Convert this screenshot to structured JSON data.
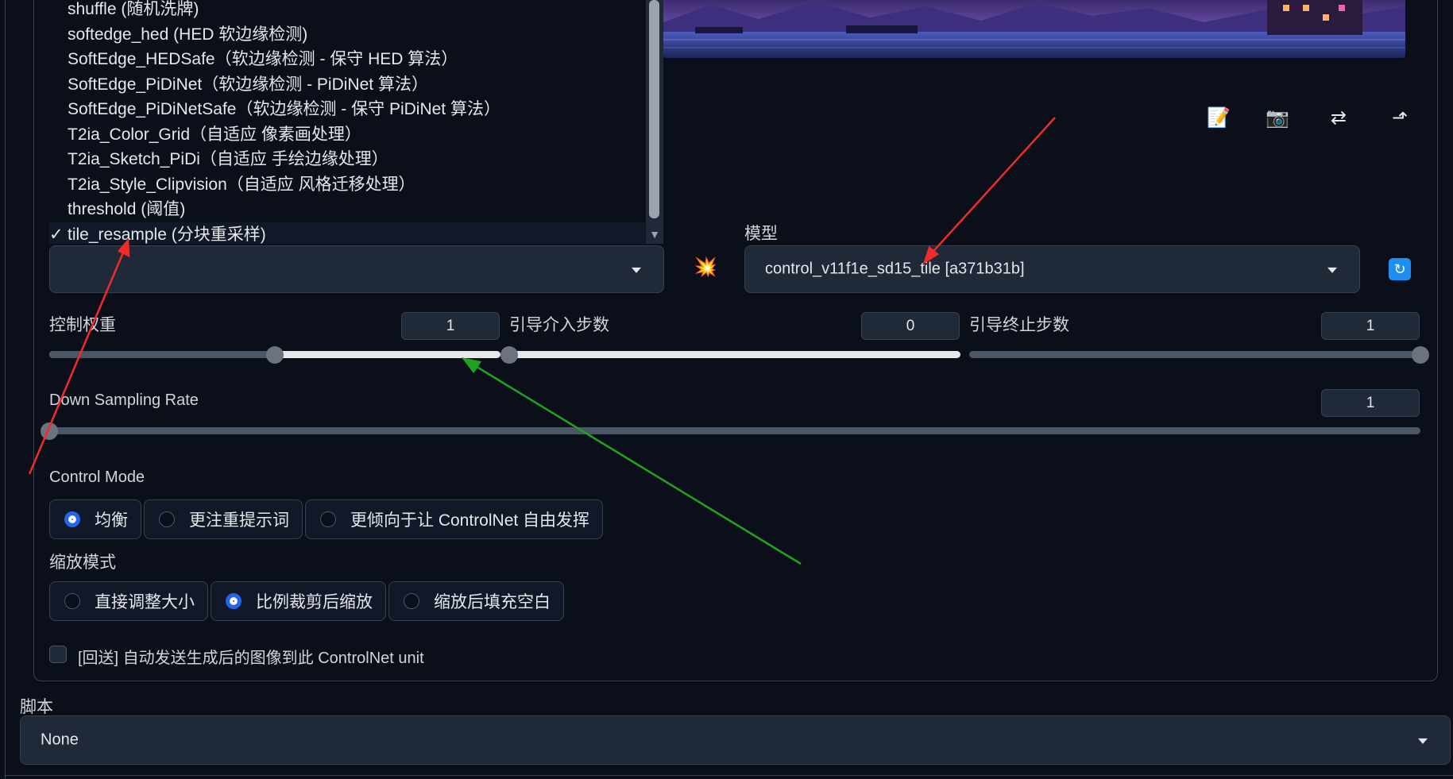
{
  "dropdown": {
    "items": [
      "shuffle (随机洗牌)",
      "softedge_hed (HED 软边缘检测)",
      "SoftEdge_HEDSafe（软边缘检测 - 保守 HED 算法）",
      "SoftEdge_PiDiNet（软边缘检测 - PiDiNet 算法）",
      "SoftEdge_PiDiNetSafe（软边缘检测 - 保守 PiDiNet 算法）",
      "T2ia_Color_Grid（自适应 像素画处理）",
      "T2ia_Sketch_PiDi（自适应 手绘边缘处理）",
      "T2ia_Style_Clipvision（自适应 风格迁移处理）",
      "threshold (阈值)",
      "tile_resample (分块重采样)"
    ],
    "selected_check": "✓"
  },
  "toolbar": {
    "edit_icon": "📝",
    "camera_icon": "📷",
    "swap_icon": "⇄",
    "send_icon": "⬏"
  },
  "preprocessor_select": {
    "value": ""
  },
  "run_preprocessor_icon": "💥",
  "model": {
    "label": "模型",
    "value": "control_v11f1e_sd15_tile [a371b31b]",
    "refresh_icon": "🔄"
  },
  "sliders": {
    "control_weight": {
      "label": "控制权重",
      "value": "1",
      "fraction": 0.5
    },
    "starting_step": {
      "label": "引导介入步数",
      "value": "0",
      "fraction": 0.0
    },
    "ending_step": {
      "label": "引导终止步数",
      "value": "1",
      "fraction": 1.0
    },
    "down_sampling": {
      "label": "Down Sampling Rate",
      "value": "1",
      "fraction": 0.0
    }
  },
  "control_mode": {
    "label": "Control Mode",
    "options": [
      "均衡",
      "更注重提示词",
      "更倾向于让 ControlNet 自由发挥"
    ],
    "selected": 0
  },
  "resize_mode": {
    "label": "缩放模式",
    "options": [
      "直接调整大小",
      "比例裁剪后缩放",
      "缩放后填充空白"
    ],
    "selected": 1
  },
  "loopback": {
    "label": "[回送] 自动发送生成后的图像到此 ControlNet unit"
  },
  "script": {
    "label": "脚本",
    "value": "None"
  },
  "colors": {
    "accent": "#2563eb",
    "arrow_red": "#ef2b2b",
    "arrow_green": "#1fa21f"
  }
}
